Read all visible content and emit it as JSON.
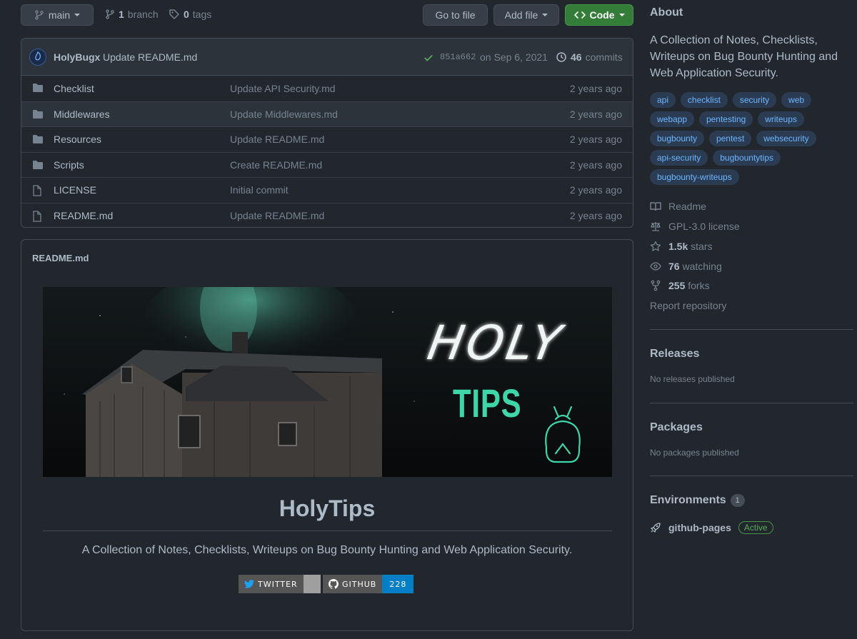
{
  "toolbar": {
    "branch_button": "main",
    "branch_count": "1",
    "branch_label": "branch",
    "tag_count": "0",
    "tag_label": "tags",
    "go_to_file": "Go to file",
    "add_file": "Add file",
    "code": "Code"
  },
  "commit": {
    "author": "HolyBugx",
    "message": "Update README.md",
    "sha": "851a662",
    "date": "on Sep 6, 2021",
    "count": "46",
    "count_label": "commits"
  },
  "files": [
    {
      "name": "Checklist",
      "type": "folder",
      "message": "Update API Security.md",
      "age": "2 years ago"
    },
    {
      "name": "Middlewares",
      "type": "folder",
      "message": "Update Middlewares.md",
      "age": "2 years ago"
    },
    {
      "name": "Resources",
      "type": "folder",
      "message": "Update README.md",
      "age": "2 years ago"
    },
    {
      "name": "Scripts",
      "type": "folder",
      "message": "Create README.md",
      "age": "2 years ago"
    },
    {
      "name": "LICENSE",
      "type": "file",
      "message": "Initial commit",
      "age": "2 years ago"
    },
    {
      "name": "README.md",
      "type": "file",
      "message": "Update README.md",
      "age": "2 years ago"
    }
  ],
  "readme": {
    "filename": "README.md",
    "banner_line1": "HOLY",
    "banner_line2": "TIPS",
    "title": "HolyTips",
    "description": "A Collection of Notes, Checklists, Writeups on Bug Bounty Hunting and Web Application Security.",
    "badges": {
      "twitter": "TWITTER",
      "github": "GITHUB",
      "github_count": "228"
    }
  },
  "about": {
    "heading": "About",
    "description": "A Collection of Notes, Checklists, Writeups on Bug Bounty Hunting and Web Application Security.",
    "topics": [
      "api",
      "checklist",
      "security",
      "web",
      "webapp",
      "pentesting",
      "writeups",
      "bugbounty",
      "pentest",
      "websecurity",
      "api-security",
      "bugbountytips",
      "bugbounty-writeups"
    ],
    "readme": "Readme",
    "license": "GPL-3.0 license",
    "stars_count": "1.5k",
    "stars_label": "stars",
    "watching_count": "76",
    "watching_label": "watching",
    "forks_count": "255",
    "forks_label": "forks",
    "report": "Report repository"
  },
  "releases": {
    "heading": "Releases",
    "text": "No releases published"
  },
  "packages": {
    "heading": "Packages",
    "text": "No packages published"
  },
  "environments": {
    "heading": "Environments",
    "count": "1",
    "name": "github-pages",
    "status": "Active"
  },
  "colors": {
    "background": "#22272e",
    "code_button": "#347d39",
    "topic_bg": "#2b3b52",
    "topic_text": "#6cb6ff",
    "banner_teal": "#3ed6a8",
    "github_badge": "#007ec6"
  }
}
